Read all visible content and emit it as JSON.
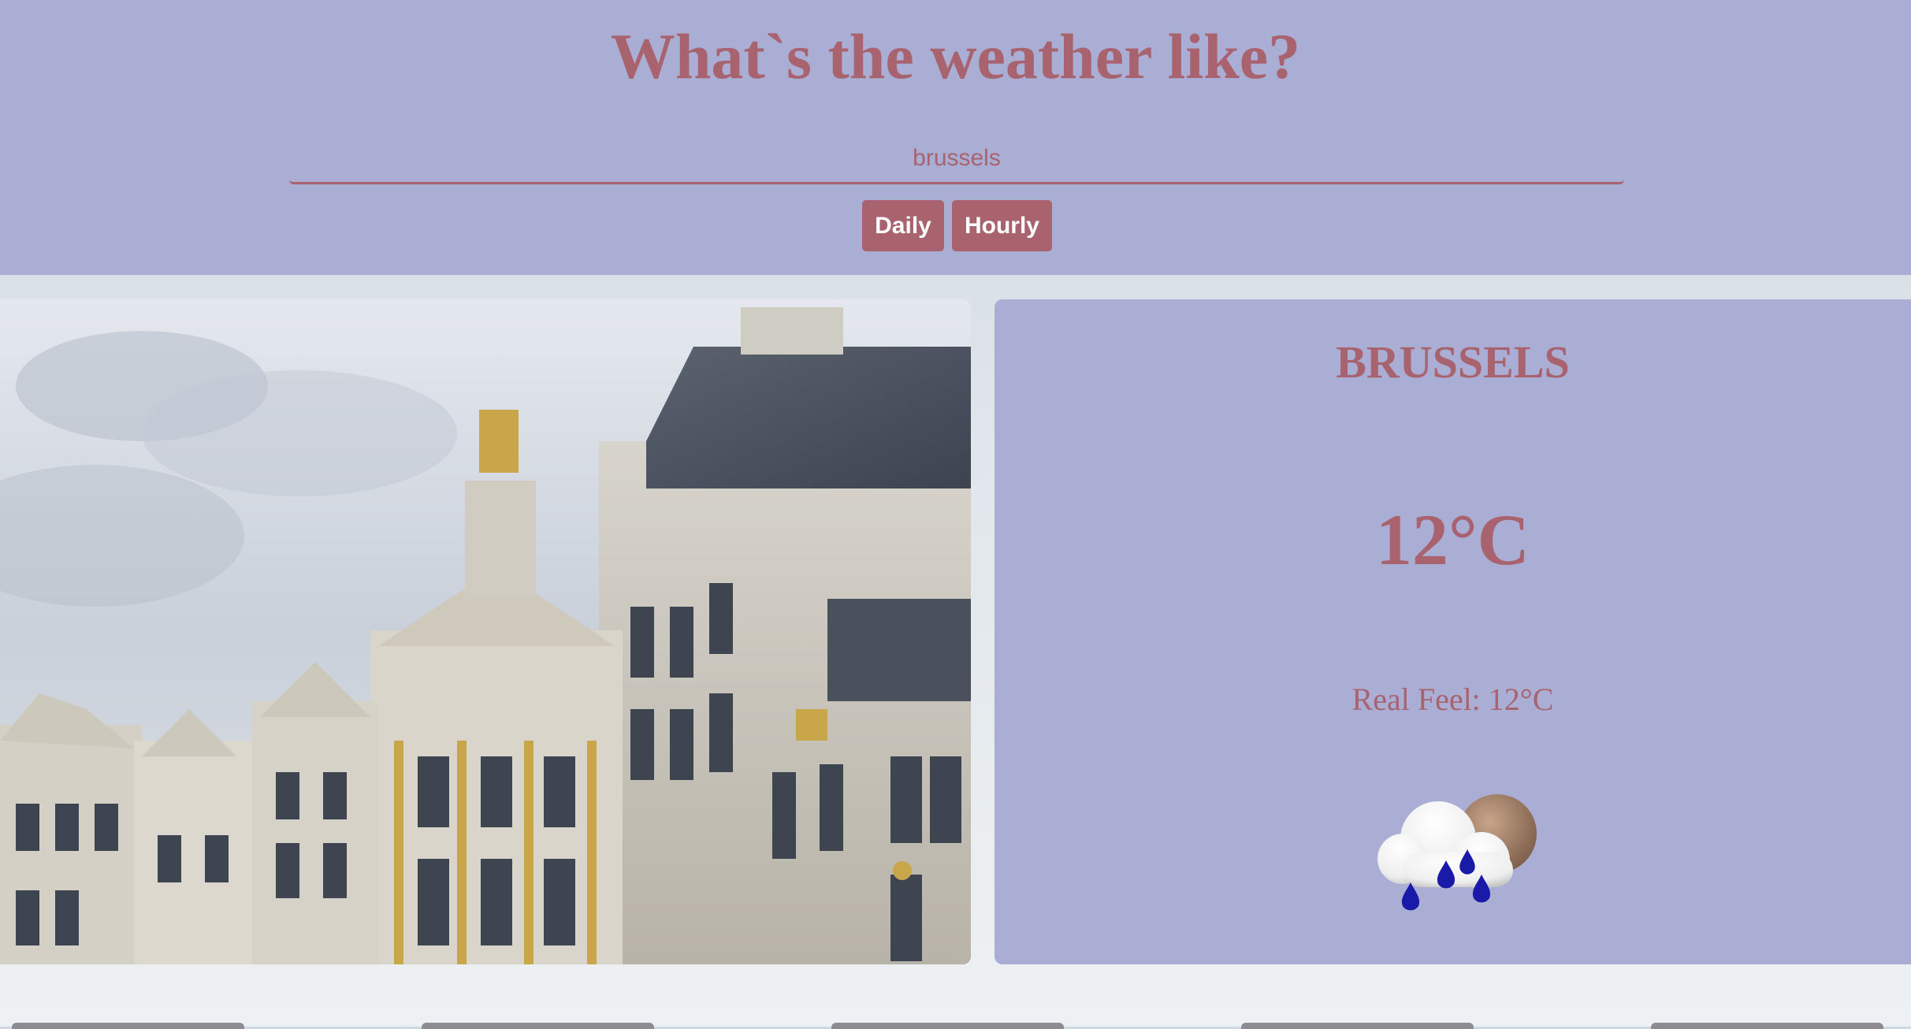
{
  "header": {
    "title": "What`s the weather like?",
    "search": {
      "value": "brussels",
      "placeholder": ""
    },
    "buttons": {
      "daily": "Daily",
      "hourly": "Hourly"
    }
  },
  "weather": {
    "city": "BRUSSELS",
    "temperature": "12°C",
    "real_feel": "Real Feel: 12°C",
    "icon": "cloud-rain-moon-icon"
  },
  "colors": {
    "header_bg": "#aaadd4",
    "accent": "#a8636f",
    "button_text": "#ffffff"
  }
}
